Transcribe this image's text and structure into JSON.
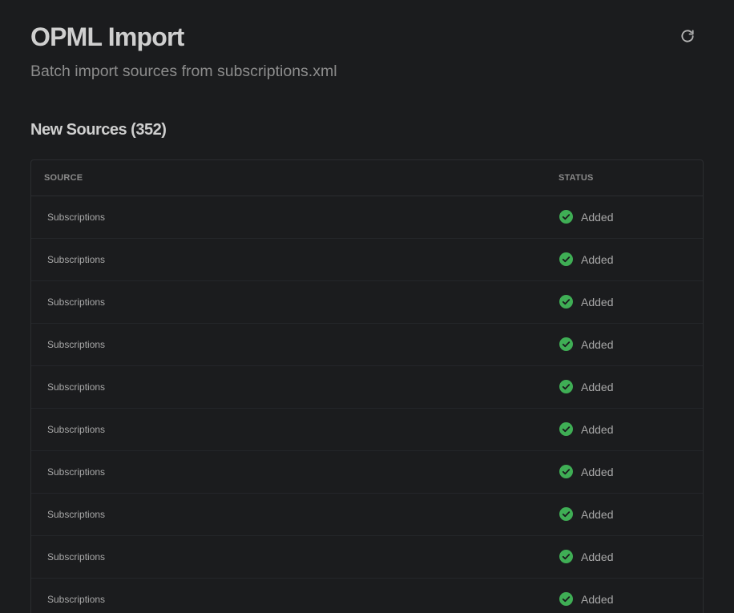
{
  "header": {
    "title": "OPML Import",
    "subtitle": "Batch import sources from subscriptions.xml",
    "refresh_icon": "refresh-icon"
  },
  "section": {
    "title": "New Sources (352)"
  },
  "table": {
    "columns": [
      "SOURCE",
      "STATUS"
    ],
    "rows": [
      {
        "source": "Subscriptions",
        "status": "Added"
      },
      {
        "source": "Subscriptions",
        "status": "Added"
      },
      {
        "source": "Subscriptions",
        "status": "Added"
      },
      {
        "source": "Subscriptions",
        "status": "Added"
      },
      {
        "source": "Subscriptions",
        "status": "Added"
      },
      {
        "source": "Subscriptions",
        "status": "Added"
      },
      {
        "source": "Subscriptions",
        "status": "Added"
      },
      {
        "source": "Subscriptions",
        "status": "Added"
      },
      {
        "source": "Subscriptions",
        "status": "Added"
      },
      {
        "source": "Subscriptions",
        "status": "Added"
      }
    ]
  },
  "colors": {
    "background": "#1b1c1e",
    "success": "#3fae55",
    "text_primary": "#cfcfcf",
    "text_secondary": "#8c8c8c"
  },
  "icons": {
    "status_added": "check-circle-icon"
  }
}
